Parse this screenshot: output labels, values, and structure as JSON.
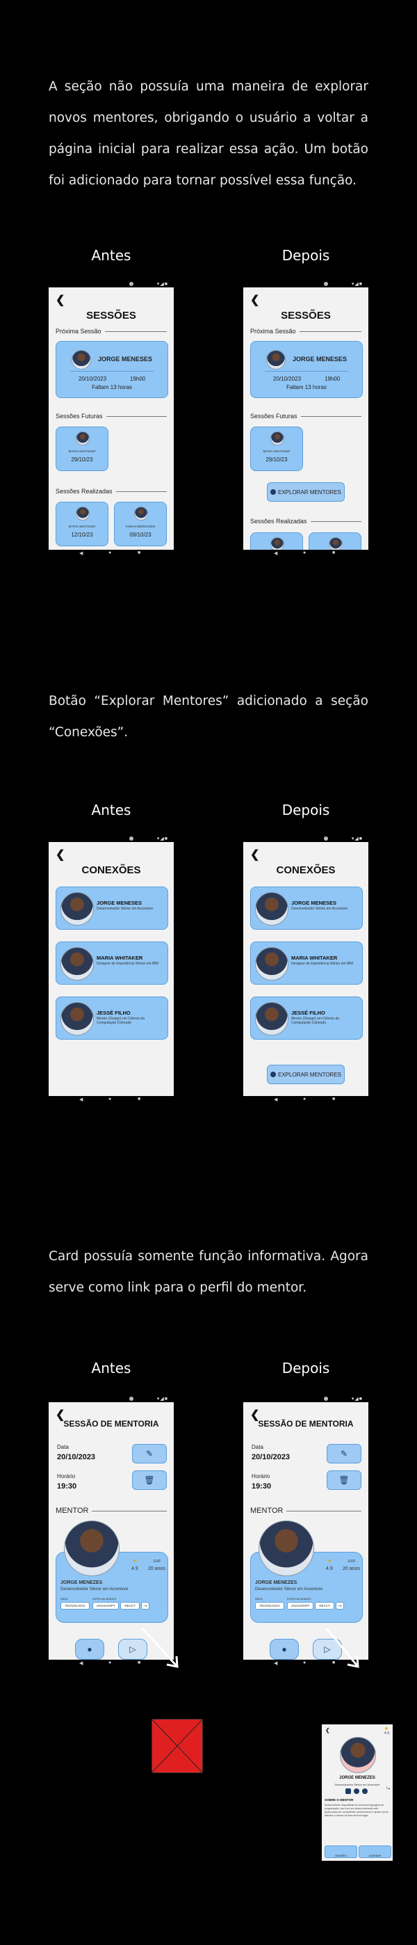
{
  "section1": {
    "text": "A seção não possuía uma maneira de explorar novos mentores, obrigando o usuário a voltar a página inicial para realizar essa ação. Um botão foi adicionado para tornar possível essa função.",
    "before_label": "Antes",
    "after_label": "Depois",
    "screen": {
      "title": "SESSÕES",
      "next_session_label": "Próxima Sessão",
      "next_name": "JORGE MENESES",
      "next_date": "20/10/2023",
      "next_time": "19h00",
      "next_remaining": "Faltam 13 horas",
      "future_label": "Sessões Futuras",
      "future_name": "MARIA WHITAKER",
      "future_date": "29/10/23",
      "done_label": "Sessões Realizadas",
      "done": [
        {
          "name": "MARIA WHITAKER",
          "date": "12/10/23"
        },
        {
          "name": "FABIAN BERNARDO",
          "date": "09/10/23"
        }
      ],
      "explore_button": "EXPLORAR MENTORES"
    }
  },
  "section2": {
    "text": "Botão “Explorar Mentores” adicionado a seção “Conexões”.",
    "before_label": "Antes",
    "after_label": "Depois",
    "screen": {
      "title": "CONEXÕES",
      "connections": [
        {
          "name": "JORGE MENESES",
          "desc": "Desenvolvedor Sênior em Accenture"
        },
        {
          "name": "MARIA WHITAKER",
          "desc": "Designer de Experiência Sênior em IBM"
        },
        {
          "name": "JESSÉ FILHO",
          "desc": "Mestre (Design) em Ciência da Computação Colorado"
        }
      ],
      "explore_button": "EXPLORAR MENTORES"
    }
  },
  "section3": {
    "text": "Card possuía somente função informativa. Agora serve como link para o perfil do mentor.",
    "before_label": "Antes",
    "after_label": "Depois",
    "screen": {
      "title": "SESSÃO DE MENTORIA",
      "date_label": "Data",
      "date_value": "20/10/2023",
      "time_label": "Horário",
      "time_value": "19:30",
      "mentor_label": "MENTOR",
      "mentor_name": "JORGE MENEZES",
      "mentor_desc": "Desenvolvedor Sênior em Accenture",
      "rating": "4.9",
      "exp_label": "EXP.",
      "exp_value": "20 anos",
      "area_label": "ÁREA",
      "spec_label": "ESPECIALIDADES",
      "chips": [
        "TECNOLOGIA",
        "JAVASCRIPT",
        "REACT",
        "+3"
      ]
    },
    "profile": {
      "rating": "4.9",
      "name": "JORGE MENEZES",
      "desc": "Desenvolvedor Sênior em Accenture",
      "about_label": "SOBRE O MENTOR",
      "about_text": "Desenvolvedor especialista em diversas linguagens de programação, com foco em desenvolvimento web. Apaixonado por compartilhar conhecimento e ajudar novos talentos a crescer na área de tecnologia.",
      "tab_left": "SESSÕES",
      "tab_right": "AGENDAR"
    }
  },
  "colors": {
    "background": "#000000",
    "card": "#90c6f5",
    "card_border": "#5a9fdc",
    "screen_bg": "#f2f2f2",
    "removed_box": "#e02020"
  }
}
